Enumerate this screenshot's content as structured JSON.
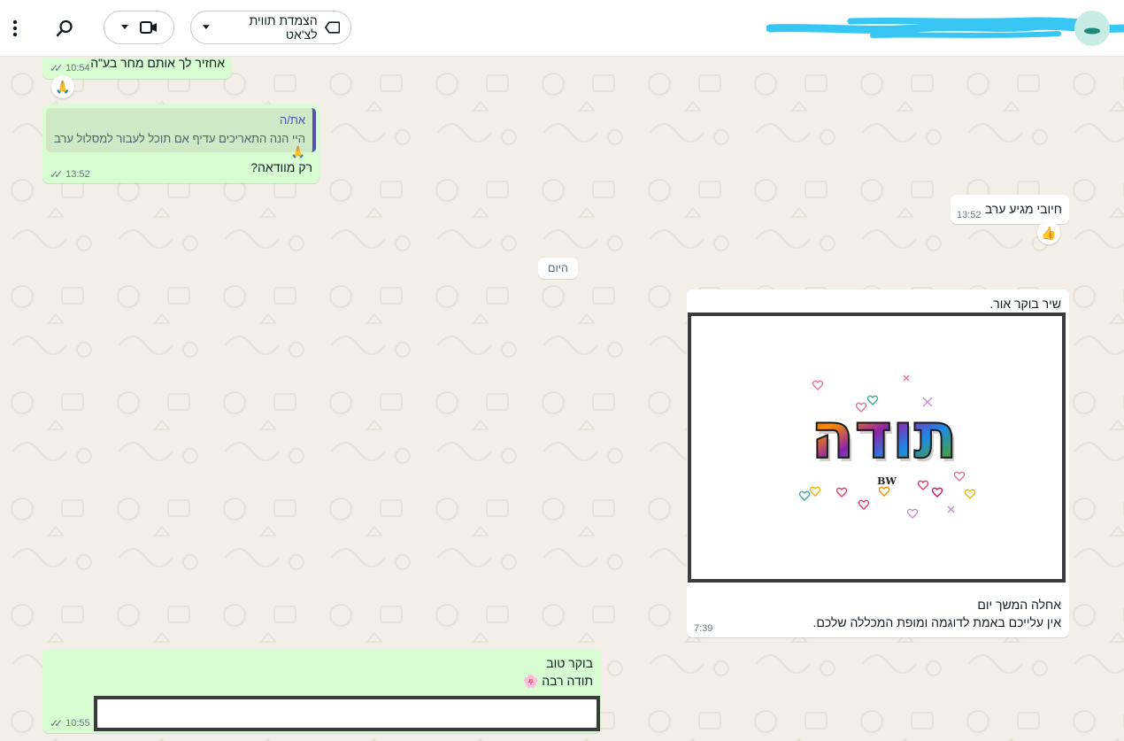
{
  "header": {
    "label_button": "הצמדת תווית לצ'אט",
    "icons": {
      "menu": "vertical-dots-icon",
      "search": "search-icon",
      "video": "video-camera-icon",
      "label": "label-tag-icon",
      "dropdown": "caret-down-icon"
    }
  },
  "messages": {
    "m1": {
      "text": "אחזיר לך אותם מחר בע\"ה",
      "time": "10:54",
      "reaction": "🙏"
    },
    "m2": {
      "quote_author": "את/ה",
      "quote_text": "היי הנה התאריכים עדיף אם תוכל לעבור למסלול ערב 🙏",
      "text": "רק מוודאה?",
      "time": "13:52"
    },
    "m3": {
      "text": "חיובי מגיע ערב",
      "time": "13:52",
      "reaction": "👍"
    },
    "date_divider": "היום",
    "m4": {
      "caption_top": "שיר בוקר אור.",
      "line1": "אחלה המשך יום",
      "line2": "אין עלייכם באמת לדוגמה ומופת המכללה שלכם.",
      "time": "7:39",
      "image_word": "תודה",
      "image_signature": "BW"
    },
    "m5": {
      "line1": "בוקר טוב",
      "line2": "תודה רבה 🌸",
      "time": "10:55"
    }
  },
  "colors": {
    "outgoing_bubble": "#d9fdd3",
    "incoming_bubble": "#ffffff",
    "chat_background": "#f3efe8",
    "quote_accent": "#5350b8",
    "name_scribble": "#38c6f4"
  }
}
